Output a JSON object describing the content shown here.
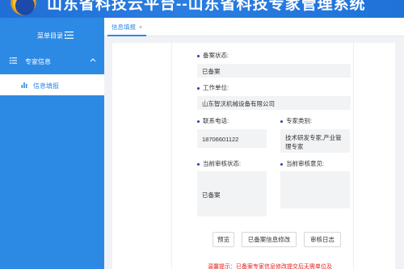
{
  "app": {
    "title": "山东省科技云平台--山东省科技专家管理系统"
  },
  "sidebar": {
    "header_label": "菜单目录",
    "group": {
      "label": "专家信息",
      "icon": "list-icon"
    },
    "items": [
      {
        "label": "信息填报",
        "icon": "bar-chart-icon",
        "active": true
      }
    ]
  },
  "tabs": [
    {
      "label": "信息填报",
      "close": "×"
    }
  ],
  "form": {
    "record_status": {
      "label": "备案状态:",
      "value": "已备案"
    },
    "work_unit": {
      "label": "工作单位:",
      "value": "山东智沃机械设备有限公司"
    },
    "phone": {
      "label": "联系电话:",
      "value": "18706601122"
    },
    "expert_category": {
      "label": "专家类别:",
      "value": "技术研发专家,产业管理专家"
    },
    "review_status": {
      "label": "当前审核状态:",
      "value": "已备案"
    },
    "review_opinion": {
      "label": "当前审核意见:",
      "value": ""
    }
  },
  "buttons": {
    "preview": "预览",
    "modify": "已备案信息修改",
    "audit_log": "审核日志"
  },
  "tip": "温馨提示：已备案专家信息修改提交后无需单位及",
  "colors": {
    "primary": "#2d8ae4",
    "header": "#2a7de1",
    "warning": "#e0201c",
    "bullet": "#1d3fb8"
  }
}
